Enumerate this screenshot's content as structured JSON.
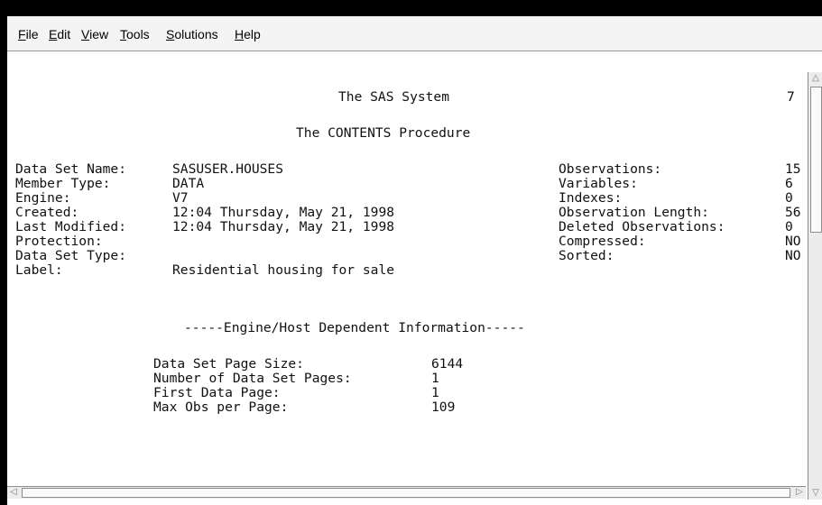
{
  "menubar": {
    "items": [
      {
        "label_u": "F",
        "label_rest": "ile"
      },
      {
        "label_u": "E",
        "label_rest": "dit"
      },
      {
        "label_u": "V",
        "label_rest": "iew"
      },
      {
        "label_u": "T",
        "label_rest": "ools"
      },
      {
        "label_u": "S",
        "label_rest": "olutions"
      },
      {
        "label_u": "H",
        "label_rest": "elp"
      }
    ]
  },
  "output": {
    "system_title": "The SAS System",
    "page_number": "7",
    "proc_title": "The CONTENTS Procedure",
    "left_fields": [
      {
        "label": "Data Set Name:",
        "value": "SASUSER.HOUSES"
      },
      {
        "label": "Member Type:",
        "value": "DATA"
      },
      {
        "label": "Engine:",
        "value": "V7"
      },
      {
        "label": "Created:",
        "value": "12:04 Thursday, May 21, 1998"
      },
      {
        "label": "Last Modified:",
        "value": "12:04 Thursday, May 21, 1998"
      },
      {
        "label": "Protection:",
        "value": ""
      },
      {
        "label": "Data Set Type:",
        "value": ""
      },
      {
        "label": "Label:",
        "value": "Residential housing for sale"
      }
    ],
    "right_fields": [
      {
        "label": "Observations:",
        "value": "15"
      },
      {
        "label": "Variables:",
        "value": "6"
      },
      {
        "label": "Indexes:",
        "value": "0"
      },
      {
        "label": "Observation Length:",
        "value": "56"
      },
      {
        "label": "Deleted Observations:",
        "value": "0"
      },
      {
        "label": "Compressed:",
        "value": "NO"
      },
      {
        "label": "Sorted:",
        "value": "NO"
      }
    ],
    "engine_header": "-----Engine/Host Dependent Information-----",
    "engine_fields": [
      {
        "label": "Data Set Page Size:",
        "value": "6144"
      },
      {
        "label": "Number of Data Set Pages:",
        "value": "1"
      },
      {
        "label": "First Data Page:",
        "value": "1"
      },
      {
        "label": "Max Obs per Page:",
        "value": "109"
      }
    ]
  },
  "icons": {
    "scroll_up": "up-arrow-icon",
    "scroll_down": "down-arrow-icon",
    "scroll_left": "left-arrow-icon",
    "scroll_right": "right-arrow-icon"
  }
}
